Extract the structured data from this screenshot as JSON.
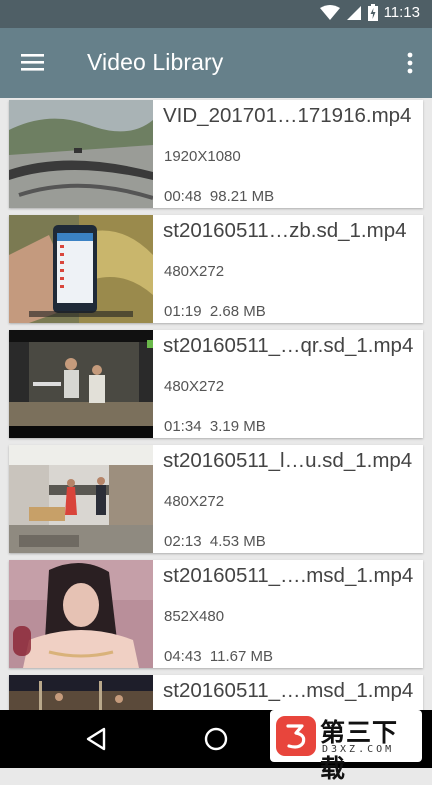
{
  "status_bar": {
    "time": "11:13",
    "icons": [
      "wifi-icon",
      "signal-icon",
      "battery-icon"
    ]
  },
  "app_bar": {
    "title": "Video Library",
    "icons": [
      "menu-icon",
      "more-vert-icon"
    ]
  },
  "videos": [
    {
      "title": "VID_201701…171916.mp4",
      "resolution": "1920X1080",
      "duration": "00:48",
      "size": "98.21 MB"
    },
    {
      "title": "st20160511…zb.sd_1.mp4",
      "resolution": "480X272",
      "duration": "01:19",
      "size": "2.68 MB"
    },
    {
      "title": "st20160511_…qr.sd_1.mp4",
      "resolution": "480X272",
      "duration": "01:34",
      "size": "3.19 MB"
    },
    {
      "title": "st20160511_l…u.sd_1.mp4",
      "resolution": "480X272",
      "duration": "02:13",
      "size": "4.53 MB"
    },
    {
      "title": "st20160511_….msd_1.mp4",
      "resolution": "852X480",
      "duration": "04:43",
      "size": "11.67 MB"
    },
    {
      "title": "st20160511_….msd_1.mp4",
      "resolution": "",
      "duration": "",
      "size": ""
    }
  ],
  "nav_bar": {
    "icons": [
      "back-icon",
      "home-icon"
    ]
  },
  "watermark": {
    "name": "第三下载",
    "url": "D3XZ.COM"
  },
  "colors": {
    "status_bar": "#4f5f66",
    "app_bar": "#66808a",
    "background": "#e9e9e9",
    "watermark_accent": "#e8453c"
  }
}
